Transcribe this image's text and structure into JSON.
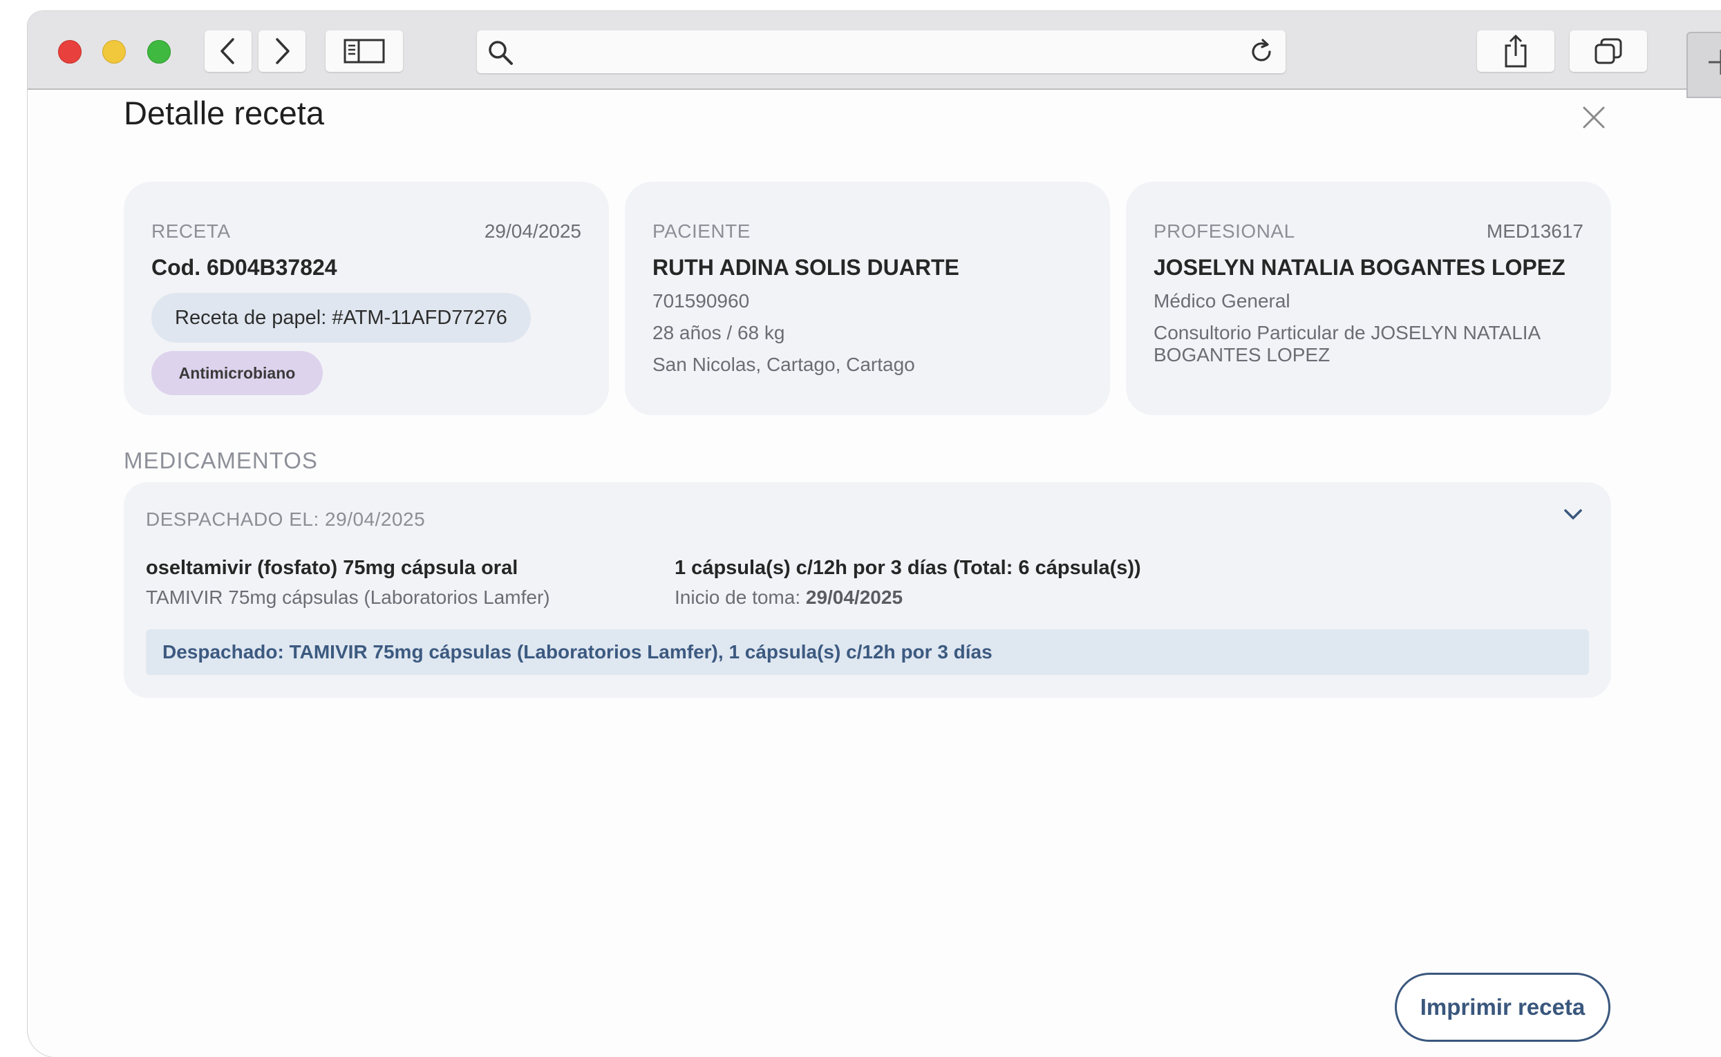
{
  "browser": {
    "icons": [
      "back-icon",
      "forward-icon",
      "sidebar-icon",
      "search-icon",
      "reload-icon",
      "share-icon",
      "tabs-icon",
      "new-tab-icon"
    ]
  },
  "modal": {
    "title": "Detalle receta",
    "close_icon": "close-icon"
  },
  "receta": {
    "label": "RECETA",
    "date": "29/04/2025",
    "code": "Cod. 6D04B37824",
    "paper": "Receta de papel: #ATM-11AFD77276",
    "badge": "Antimicrobiano",
    "badge_color": "#ddd3ed"
  },
  "paciente": {
    "label": "PACIENTE",
    "name": "RUTH ADINA SOLIS DUARTE",
    "id": "701590960",
    "age_weight": "28 años / 68 kg",
    "location": "San Nicolas, Cartago, Cartago"
  },
  "profesional": {
    "label": "PROFESIONAL",
    "code": "MED13617",
    "name": "JOSELYN NATALIA BOGANTES LOPEZ",
    "specialty": "Médico General",
    "office": "Consultorio Particular de JOSELYN NATALIA BOGANTES LOPEZ"
  },
  "medicamentos": {
    "section_label": "MEDICAMENTOS",
    "dispatched_label": "DESPACHADO EL: 29/04/2025",
    "items": [
      {
        "name": "oseltamivir (fosfato) 75mg cápsula oral",
        "brand": "TAMIVIR 75mg cápsulas (Laboratorios Lamfer)",
        "dosage": "1 cápsula(s) c/12h por 3 días (Total: 6 cápsula(s))",
        "start_label": "Inicio de toma: ",
        "start_date": "29/04/2025",
        "dispatch_note": "Despachado: TAMIVIR 75mg cápsulas (Laboratorios Lamfer), 1 cápsula(s) c/12h por 3 días"
      }
    ]
  },
  "actions": {
    "print_label": "Imprimir receta"
  },
  "colors": {
    "accent": "#3a577d",
    "card_bg": "#f2f3f7",
    "dispatch_bg": "#dfe7f1"
  }
}
